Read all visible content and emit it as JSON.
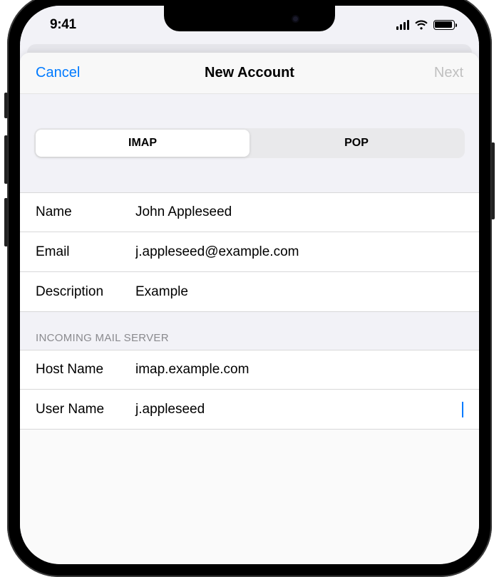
{
  "status": {
    "time": "9:41"
  },
  "nav": {
    "cancel": "Cancel",
    "title": "New Account",
    "next": "Next"
  },
  "segments": {
    "imap": "IMAP",
    "pop": "POP",
    "selected": "IMAP"
  },
  "account": {
    "rows": [
      {
        "label": "Name",
        "value": "John Appleseed"
      },
      {
        "label": "Email",
        "value": "j.appleseed@example.com"
      },
      {
        "label": "Description",
        "value": "Example"
      }
    ]
  },
  "incoming": {
    "header": "Incoming Mail Server",
    "rows": [
      {
        "label": "Host Name",
        "value": "imap.example.com"
      },
      {
        "label": "User Name",
        "value": "j.appleseed"
      }
    ]
  }
}
